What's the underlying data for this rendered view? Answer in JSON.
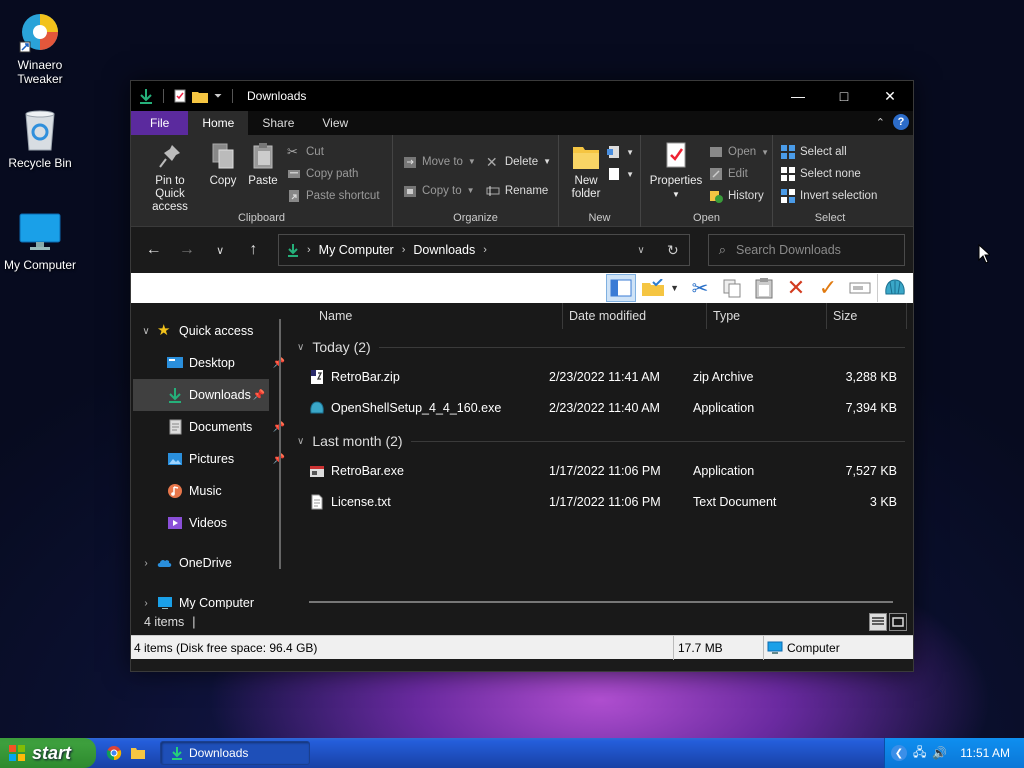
{
  "desktop": {
    "icons": [
      {
        "label_line1": "Winaero",
        "label_line2": "Tweaker",
        "icon": "winaero-tweaker-icon"
      },
      {
        "label": "Recycle Bin",
        "icon": "recycle-bin-icon"
      },
      {
        "label": "My Computer",
        "icon": "monitor-icon"
      }
    ]
  },
  "window": {
    "title": "Downloads",
    "tabs": [
      "File",
      "Home",
      "Share",
      "View"
    ],
    "active_tab": "Home",
    "colors": {
      "file_tab": "#5b2a9e",
      "accent": "#2c6cc9"
    }
  },
  "ribbon": {
    "clipboard": {
      "label": "Clipboard",
      "pin_line1": "Pin to Quick",
      "pin_line2": "access",
      "copy": "Copy",
      "paste": "Paste",
      "cut": "Cut",
      "copy_path": "Copy path",
      "paste_shortcut": "Paste shortcut"
    },
    "organize": {
      "label": "Organize",
      "move_to": "Move to",
      "copy_to": "Copy to",
      "delete": "Delete",
      "rename": "Rename"
    },
    "new": {
      "label": "New",
      "new_folder_line1": "New",
      "new_folder_line2": "folder"
    },
    "open": {
      "label": "Open",
      "properties": "Properties",
      "open": "Open",
      "edit": "Edit",
      "history": "History"
    },
    "select": {
      "label": "Select",
      "select_all": "Select all",
      "select_none": "Select none",
      "invert": "Invert selection"
    }
  },
  "address": {
    "crumbs": [
      "My Computer",
      "Downloads"
    ],
    "search_placeholder": "Search Downloads"
  },
  "nav": {
    "quick_access": "Quick access",
    "items": [
      {
        "label": "Desktop",
        "icon": "desktop-icon",
        "pinned": true
      },
      {
        "label": "Downloads",
        "icon": "download-icon",
        "pinned": true,
        "selected": true
      },
      {
        "label": "Documents",
        "icon": "documents-icon",
        "pinned": true
      },
      {
        "label": "Pictures",
        "icon": "pictures-icon",
        "pinned": true
      },
      {
        "label": "Music",
        "icon": "music-icon",
        "pinned": false
      },
      {
        "label": "Videos",
        "icon": "videos-icon",
        "pinned": false
      }
    ],
    "onedrive": "OneDrive",
    "my_computer": "My Computer"
  },
  "files": {
    "columns": [
      "Name",
      "Date modified",
      "Type",
      "Size"
    ],
    "groups": [
      {
        "label": "Today (2)",
        "rows": [
          {
            "name": "RetroBar.zip",
            "date": "2/23/2022 11:41 AM",
            "type": "zip Archive",
            "size": "3,288 KB",
            "icon": "zip-icon"
          },
          {
            "name": "OpenShellSetup_4_4_160.exe",
            "date": "2/23/2022 11:40 AM",
            "type": "Application",
            "size": "7,394 KB",
            "icon": "shell-icon"
          }
        ]
      },
      {
        "label": "Last month (2)",
        "rows": [
          {
            "name": "RetroBar.exe",
            "date": "1/17/2022 11:06 PM",
            "type": "Application",
            "size": "7,527 KB",
            "icon": "app-icon"
          },
          {
            "name": "License.txt",
            "date": "1/17/2022 11:06 PM",
            "type": "Text Document",
            "size": "3 KB",
            "icon": "text-file-icon"
          }
        ]
      }
    ]
  },
  "status": {
    "items_count": "4 items",
    "summary": "4 items (Disk free space: 96.4 GB)",
    "size": "17.7 MB",
    "location": "Computer"
  },
  "taskbar": {
    "start": "start",
    "task": "Downloads",
    "clock": "11:51 AM"
  }
}
